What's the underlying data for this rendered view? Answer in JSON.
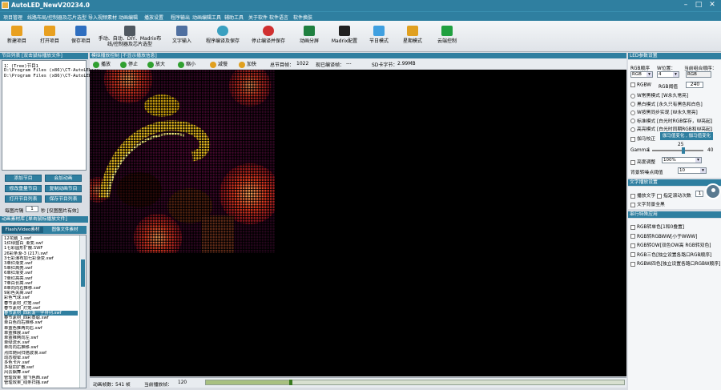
{
  "window": {
    "title": "AutoLED_NewV20234.0"
  },
  "menu": [
    "项目管理",
    "线路布局/控制器及芯片选型",
    "导入视频素材",
    "动画编辑",
    "播放设置",
    "程序输出",
    "动画编辑工具",
    "辅助工具",
    "关于软件",
    "软件语言",
    "软件换肤"
  ],
  "toolbar": [
    {
      "label": "新建项目",
      "icon": "folder-new-icon",
      "color": "#e8a020"
    },
    {
      "label": "打开项目",
      "icon": "folder-open-icon",
      "color": "#e8a020"
    },
    {
      "label": "保存项目",
      "icon": "save-icon",
      "color": "#2f6fc0"
    },
    {
      "label": "手动、自动、DIY、Madrix布线/控制器及芯片选型",
      "icon": "wiring-icon",
      "color": "#505860"
    },
    {
      "label": "文字输入",
      "icon": "text-input-icon",
      "color": "#5070a0"
    },
    {
      "label": "程序编译及保存",
      "icon": "compile-icon",
      "color": "#3aa0c0"
    },
    {
      "label": "停止编译并保存",
      "icon": "stop-compile-icon",
      "color": "#d03030"
    },
    {
      "label": "动画分屏",
      "icon": "split-screen-icon",
      "color": "#208040"
    },
    {
      "label": "Madrix配置",
      "icon": "madrix-icon",
      "color": "#202020"
    },
    {
      "label": "节日模式",
      "icon": "holiday-icon",
      "color": "#40a0e0"
    },
    {
      "label": "星期模式",
      "icon": "week-icon",
      "color": "#e0a020"
    },
    {
      "label": "云端控制",
      "icon": "cloud-control-icon",
      "color": "#20a040"
    }
  ],
  "left": {
    "program_list_title": "节目列表 [双击鼠标播放文件]",
    "program_list_lines": [
      "1：(Tree)节目1",
      "D:\\Program Files (x86)\\CT-AutoLED\\sw",
      "D:\\Program Files (x86)\\CT-AutoLED\\sw"
    ],
    "buttons": [
      "添加节目",
      "会加动画",
      "修改重量节目",
      "复制动画节目",
      "打开节目列表",
      "保存节目列表"
    ],
    "per_file_label": "每图片隔",
    "per_file_value": "1",
    "per_file_unit": "秒 [仅图图片有效]",
    "anim_title": "动画素材库 [单击鼠标播放文件]",
    "anim_tabs": [
      "Flash/Video素材",
      "图像文件素材"
    ],
    "anim_items": [
      "12花脑_1.swf",
      "1红绿蓝白_渐变.swf",
      "1七彩圆形扩散.SWF",
      "26彩条渐-3 (217).swf",
      "3七彩瀑布加七彩渐变.swf",
      "3单红渐变.swf",
      "5单红高亮.swf",
      "6单红渐变.swf",
      "7单红高亮.swf",
      "7单白长高.swf",
      "8单向向右推移.swf",
      "9彩色关高.swf",
      "彩色气球.swf",
      "春节素材_灯笼.swf",
      "春节素材_灯笼.swf",
      "春节素材_四彩渐一字排列.swf",
      "春节素材_四彩蒸聪.swf",
      "单白色向右推移.swf",
      "单蓝色推两向右.swf",
      "单蓝推展.swf",
      "单蓝推两向左.swf",
      "单绿流水.swf",
      "单向向右推移.swf",
      "点阵随间扫描波浪.swf",
      "动态银晕.swf",
      "多色卡片.swf",
      "多极扣扩散.swf",
      "风云飘舞.swf",
      "管理效果_窗飞色西.swf",
      "管理效果_线条扫描.swf"
    ],
    "anim_selected": 15
  },
  "center": {
    "title": "模拟播放控制 [不显示播放信息]",
    "controls": [
      {
        "label": "播放",
        "icon": "play-icon",
        "color": "#30a030"
      },
      {
        "label": "停止",
        "icon": "stop-icon",
        "color": "#30a030"
      },
      {
        "label": "放大",
        "icon": "zoom-in-icon",
        "color": "#30a030"
      },
      {
        "label": "缩小",
        "icon": "zoom-out-icon",
        "color": "#30a030"
      },
      {
        "label": "减慢",
        "icon": "slow-down-icon",
        "color": "#e0a020"
      },
      {
        "label": "加快",
        "icon": "speed-up-icon",
        "color": "#e0a020"
      }
    ],
    "total_frames_label": "总节目帧：",
    "total_frames": "1022",
    "compiled_label": "现已编译帧：",
    "compiled": "---",
    "sd_bytes_label": "SD卡字节：",
    "sd_bytes": "2.99MB",
    "anim_frames_label": "动画帧数：",
    "anim_frames": "541 帧",
    "current_frame_label": "当前播放帧：",
    "current_frame": "120",
    "progress": 0.2
  },
  "right": {
    "led_title": "LED参数设置",
    "rgb_label": "RGB顺序",
    "w_label": "W位置：",
    "current_order_label": "当前组合顺序：",
    "rgb_value": "RGB",
    "w_value": "4",
    "current_order_value": "RGB",
    "rgbw_label": "RGBW",
    "rgb_threshold_label": "RGB阈值",
    "rgb_threshold_value": "240",
    "modes": [
      "W常黑模式 [W永久常亮]",
      "黑白模式 [永久只有黑色和白色]",
      "W按黑同步实现 [W永久常亮]",
      "标准模式 [白光时RGB保存，W亮起]",
      "高亮模式 [白光时同期RGB和W亮起]"
    ],
    "gamma_correction_label": "伽马校正",
    "gamma_btn1": "伽马值变化",
    "gamma_btn2": "伽马值变化",
    "gamma_label": "Gamma",
    "gamma_min": "1",
    "gamma_value": "25",
    "gamma_max": "40",
    "gamma_fraction": 0.62,
    "brightness_label": "亮度调整",
    "brightness_value": "100%",
    "bg_threshold_label": "背景转噪点阈值",
    "bg_threshold_value": "10",
    "text_title": "文字播放设置",
    "play_text_label": "播放文字",
    "scroll_label": "指定滚动次数",
    "scroll_value": "1",
    "text_bg_label": "文字背景全黑",
    "special_title": "串行特殊应用",
    "special": [
      "RGB转单色[1和0叠置]",
      "RGB转RGBWW[小于WWW]",
      "RGB转OW[双色OW高 RGB转双色]",
      "RGB三色[独立设置各路口RGB顺序]",
      "RGBW四色[独立设置各路口RGBW顺序]"
    ]
  }
}
